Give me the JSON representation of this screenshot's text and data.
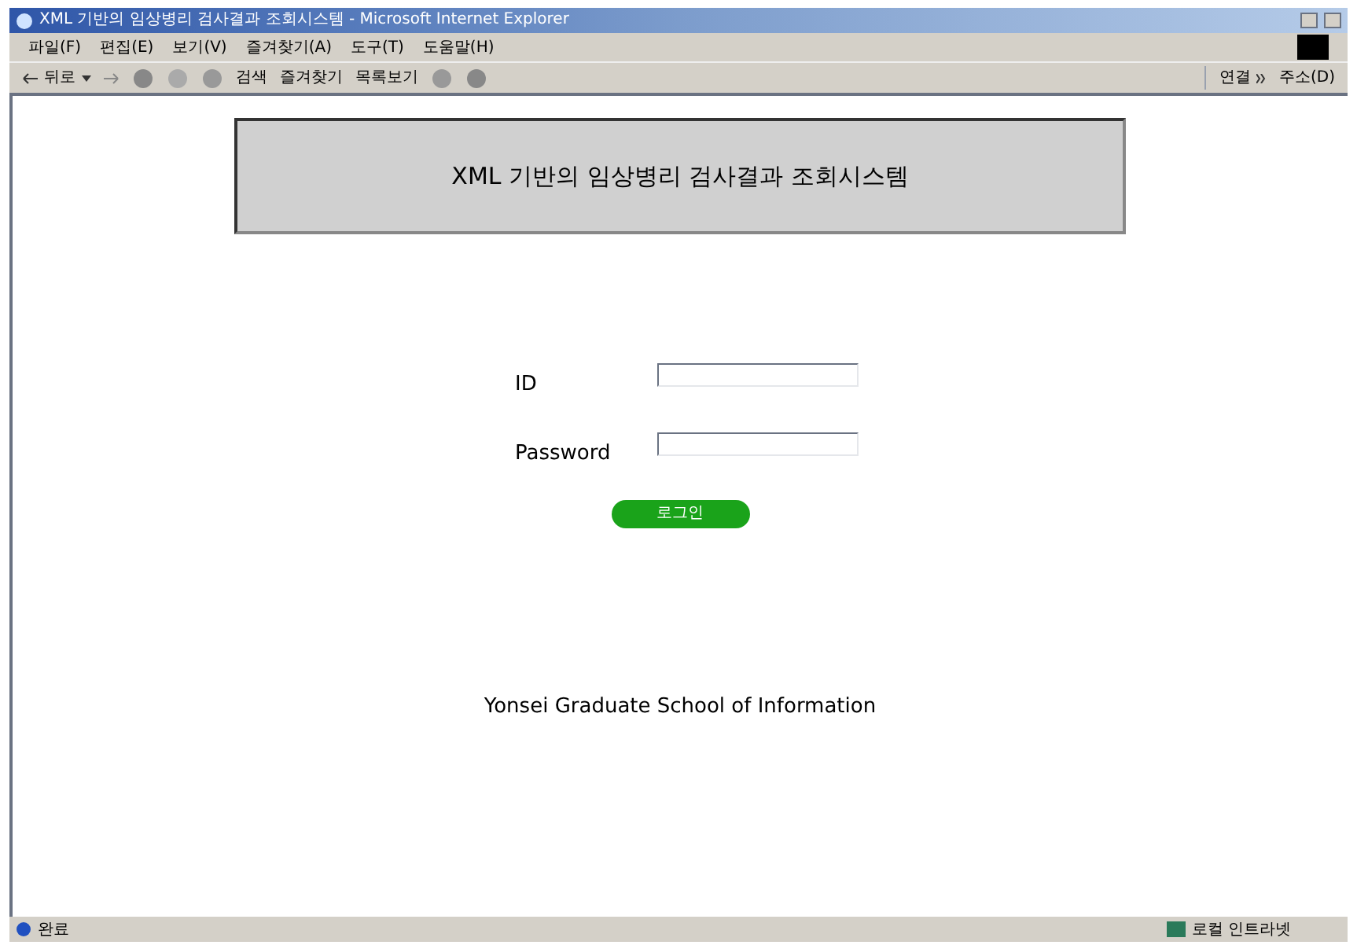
{
  "window": {
    "title": "XML 기반의 임상병리 검사결과 조회시스템 - Microsoft Internet Explorer"
  },
  "menu": [
    "파일(F)",
    "편집(E)",
    "보기(V)",
    "즐겨찾기(A)",
    "도구(T)",
    "도움말(H)"
  ],
  "toolbar": {
    "back": "뒤로",
    "search": "검색",
    "favorites": "즐겨찾기",
    "history": "목록보기",
    "links": "연결",
    "address": "주소(D)"
  },
  "page": {
    "header": "XML 기반의 임상병리 검사결과 조회시스템",
    "fields": [
      {
        "label": "ID"
      },
      {
        "label": "Password"
      }
    ],
    "login_button": "로그인",
    "footer": "Yonsei Graduate School of Information"
  },
  "status_bar": {
    "status": "완료",
    "zone": "로컬 인트라넷"
  }
}
